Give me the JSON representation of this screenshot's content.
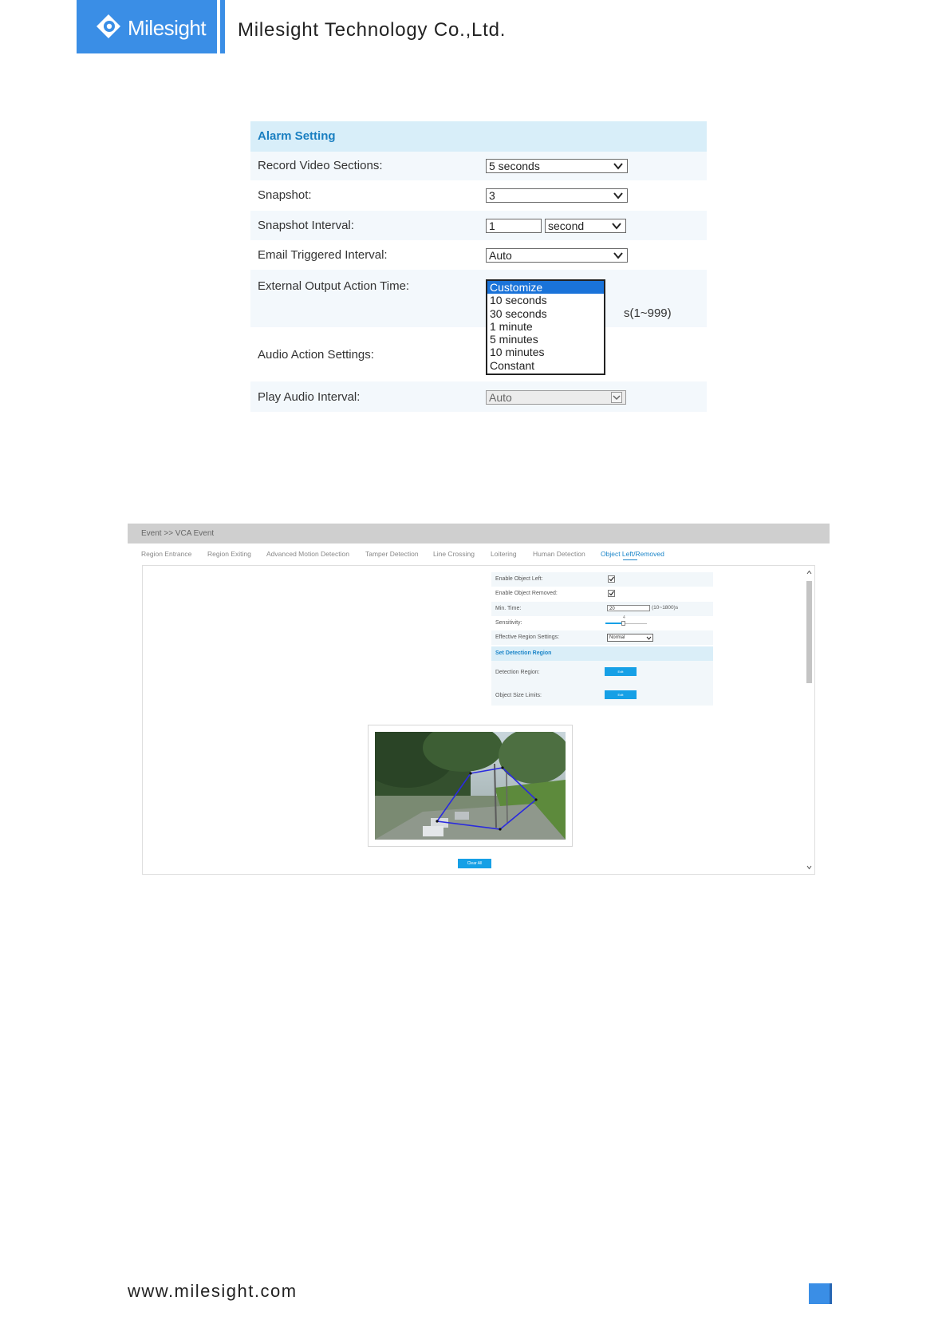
{
  "header": {
    "logo_text": "Milesight",
    "company": "Milesight Technology Co.,Ltd."
  },
  "alarm_setting": {
    "title": "Alarm Setting",
    "record_video_sections": {
      "label": "Record Video Sections:",
      "value": "5 seconds"
    },
    "snapshot": {
      "label": "Snapshot:",
      "value": "3"
    },
    "snapshot_interval": {
      "label": "Snapshot Interval:",
      "value": "1",
      "unit": "second"
    },
    "email_triggered_interval": {
      "label": "Email Triggered Interval:",
      "value": "Auto"
    },
    "external_output_action_time": {
      "label": "External Output Action Time:",
      "options": [
        "Customize",
        "10 seconds",
        "30 seconds",
        "1 minute",
        "5 minutes",
        "10 minutes",
        "Constant"
      ],
      "selected": "Customize",
      "range_hint": "s(1~999)"
    },
    "audio_action_settings": {
      "label": "Audio Action Settings:"
    },
    "play_audio_interval": {
      "label": "Play Audio Interval:",
      "value": "Auto"
    }
  },
  "vca_event": {
    "breadcrumb": "Event >> VCA Event",
    "tabs": [
      "Region Entrance",
      "Region Exiting",
      "Advanced Motion Detection",
      "Tamper Detection",
      "Line Crossing",
      "Loitering",
      "Human Detection",
      "Object Left/Removed"
    ],
    "active_tab": "Object Left/Removed",
    "enable_object_left": {
      "label": "Enable Object Left:",
      "checked": true
    },
    "enable_object_removed": {
      "label": "Enable Object Removed:",
      "checked": true
    },
    "min_time": {
      "label": "Min. Time:",
      "value": "20",
      "hint": "(10~1800)s"
    },
    "sensitivity": {
      "label": "Sensitivity:",
      "value": "4"
    },
    "effective_region_settings": {
      "label": "Effective Region Settings:",
      "value": "Normal"
    },
    "set_detection_region": "Set Detection Region",
    "detection_region": {
      "label": "Detection Region:",
      "button": "Edit"
    },
    "object_size_limits": {
      "label": "Object Size Limits:",
      "button": "Edit"
    },
    "clear_all": "Clear All"
  },
  "footer": {
    "url": "www.milesight.com"
  },
  "colors": {
    "brand": "#3a8ee6",
    "panel_header": "#d8eef9",
    "panel_row": "#f3f8fc",
    "dropdown_selected": "#1a73d9",
    "vca_button": "#16a0e6",
    "vca_active_tab": "#1d86c9"
  }
}
